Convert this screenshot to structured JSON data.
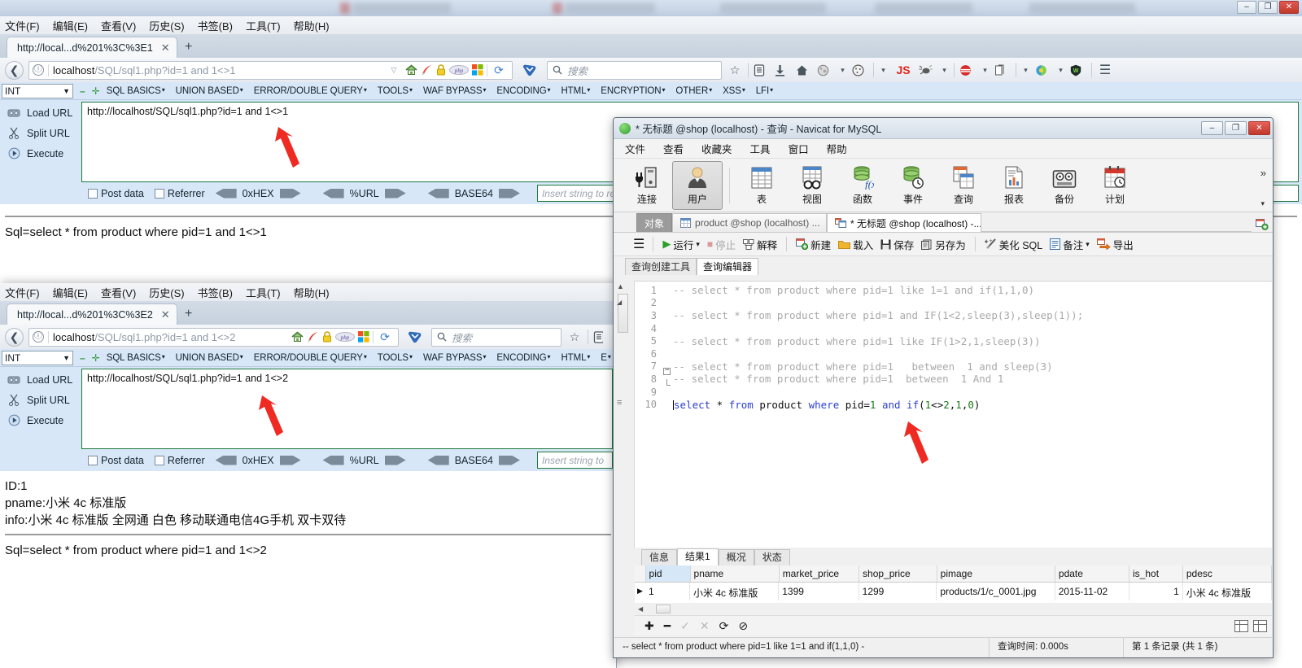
{
  "taskbar": {
    "minimize": "–",
    "maximize": "❐",
    "close": "✕"
  },
  "browser_back": {
    "menubar": [
      "文件(F)",
      "编辑(E)",
      "查看(V)",
      "历史(S)",
      "书签(B)",
      "工具(T)",
      "帮助(H)"
    ],
    "tab_title": "http://local...d%201%3C%3E1",
    "tab_close": "✕",
    "new_tab": "+",
    "back_arrow": "❮",
    "info_icon": "ⓘ",
    "url_host": "localhost",
    "url_path": "/SQL/sql1.php?id=1 and 1<>1",
    "reload": "⟳",
    "search_placeholder": "搜索",
    "hackbar": {
      "type_value": "INT",
      "dropdown_caret": "▼",
      "minus": "–",
      "plus": "✛",
      "menus": [
        "SQL BASICS",
        "UNION BASED",
        "ERROR/DOUBLE QUERY",
        "TOOLS",
        "WAF BYPASS",
        "ENCODING",
        "HTML",
        "ENCRYPTION",
        "OTHER",
        "XSS",
        "LFI"
      ],
      "load_url": "Load URL",
      "split_url": "Split URL",
      "execute": "Execute",
      "textarea_value": "http://localhost/SQL/sql1.php?id=1 and 1<>1",
      "post_data": "Post data",
      "referrer": "Referrer",
      "hex": "0xHEX",
      "url_enc": "%URL",
      "base64": "BASE64",
      "replace_placeholder": "Insert string to replace"
    },
    "page_sql": "Sql=select * from product where pid=1 and 1<>1"
  },
  "browser_front": {
    "menubar": [
      "文件(F)",
      "编辑(E)",
      "查看(V)",
      "历史(S)",
      "书签(B)",
      "工具(T)",
      "帮助(H)"
    ],
    "tab_title": "http://local...d%201%3C%3E2",
    "tab_close": "✕",
    "new_tab": "+",
    "back_arrow": "❮",
    "info_icon": "ⓘ",
    "url_host": "localhost",
    "url_path": "/SQL/sql1.php?id=1 and 1<>2",
    "reload": "⟳",
    "search_placeholder": "搜索",
    "hackbar": {
      "type_value": "INT",
      "dropdown_caret": "▼",
      "minus": "–",
      "plus": "✛",
      "menus": [
        "SQL BASICS",
        "UNION BASED",
        "ERROR/DOUBLE QUERY",
        "TOOLS",
        "WAF BYPASS",
        "ENCODING",
        "HTML",
        "E"
      ],
      "load_url": "Load URL",
      "split_url": "Split URL",
      "execute": "Execute",
      "textarea_value": "http://localhost/SQL/sql1.php?id=1 and 1<>2",
      "post_data": "Post data",
      "referrer": "Referrer",
      "hex": "0xHEX",
      "url_enc": "%URL",
      "base64": "BASE64",
      "replace_placeholder": "Insert string to rep"
    },
    "page_lines": [
      "ID:1",
      "pname:小米 4c 标准版",
      "info:小米 4c 标准版 全网通 白色 移动联通电信4G手机 双卡双待"
    ],
    "page_sql": "Sql=select * from product where pid=1 and 1<>2"
  },
  "navicat": {
    "title": "* 无标题 @shop (localhost) - 查询 - Navicat for MySQL",
    "window_controls": {
      "minimize": "–",
      "maximize": "❐",
      "close": "✕"
    },
    "menubar": [
      "文件",
      "查看",
      "收藏夹",
      "工具",
      "窗口",
      "帮助"
    ],
    "toolbar": [
      {
        "label": "连接",
        "icon": "connection-icon",
        "selected": false
      },
      {
        "label": "用户",
        "icon": "user-icon",
        "selected": true
      },
      {
        "label": "表",
        "icon": "table-icon",
        "selected": false
      },
      {
        "label": "视图",
        "icon": "view-icon",
        "selected": false
      },
      {
        "label": "函数",
        "icon": "function-icon",
        "selected": false
      },
      {
        "label": "事件",
        "icon": "event-icon",
        "selected": false
      },
      {
        "label": "查询",
        "icon": "query-icon",
        "selected": false
      },
      {
        "label": "报表",
        "icon": "report-icon",
        "selected": false
      },
      {
        "label": "备份",
        "icon": "backup-icon",
        "selected": false
      },
      {
        "label": "计划",
        "icon": "schedule-icon",
        "selected": false
      }
    ],
    "toolbar_overflow": "»",
    "tabs": [
      {
        "label": "对象",
        "kind": "objects"
      },
      {
        "label": "product @shop (localhost) ...",
        "kind": "table"
      },
      {
        "label": "* 无标题 @shop (localhost) -...",
        "kind": "query",
        "active": true
      }
    ],
    "query_toolbar": {
      "menu_icon": "hamburger-icon",
      "run": "运行",
      "run_caret": "▾",
      "stop": "停止",
      "explain": "解释",
      "new": "新建",
      "load": "载入",
      "save": "保存",
      "save_as": "另存为",
      "beautify": "美化 SQL",
      "note": "备注",
      "note_caret": "▾",
      "export": "导出"
    },
    "sub_tabs": [
      {
        "label": "查询创建工具",
        "active": false
      },
      {
        "label": "查询编辑器",
        "active": true
      }
    ],
    "editor_lines": [
      {
        "n": "1",
        "text": "-- select * from product where pid=1 like 1=1 and if(1,1,0)",
        "active": false,
        "fold": ""
      },
      {
        "n": "2",
        "text": "",
        "active": false,
        "fold": ""
      },
      {
        "n": "3",
        "text": "-- select * from product where pid=1 and IF(1<2,sleep(3),sleep(1));",
        "active": false,
        "fold": ""
      },
      {
        "n": "4",
        "text": "",
        "active": false,
        "fold": ""
      },
      {
        "n": "5",
        "text": "-- select * from product where pid=1 like IF(1>2,1,sleep(3))",
        "active": false,
        "fold": ""
      },
      {
        "n": "6",
        "text": "",
        "active": false,
        "fold": ""
      },
      {
        "n": "7",
        "text": "-- select * from product where pid=1   between  1 and sleep(3)",
        "active": false,
        "fold": "start"
      },
      {
        "n": "8",
        "text": "-- select * from product where pid=1  between  1 And 1",
        "active": false,
        "fold": "end"
      },
      {
        "n": "9",
        "text": "",
        "active": false,
        "fold": ""
      },
      {
        "n": "10",
        "text": "select * from product where pid=1 and if(1<>2,1,0)",
        "active": true,
        "fold": ""
      }
    ],
    "result_tabs": [
      {
        "label": "信息",
        "active": false
      },
      {
        "label": "结果1",
        "active": true
      },
      {
        "label": "概况",
        "active": false
      },
      {
        "label": "状态",
        "active": false
      }
    ],
    "result_columns": [
      "pid",
      "pname",
      "market_price",
      "shop_price",
      "pimage",
      "pdate",
      "is_hot",
      "pdesc"
    ],
    "result_rows": [
      {
        "marker": "▶",
        "cells": [
          "1",
          "小米 4c 标准版",
          "1399",
          "1299",
          "products/1/c_0001.jpg",
          "2015-11-02",
          "1",
          "小米 4c 标准版"
        ]
      }
    ],
    "bottom_bar": {
      "add": "✚",
      "remove": "━",
      "confirm": "✓",
      "cancel": "✕",
      "refresh": "⟳",
      "stop": "⊘",
      "grid_view": "grid-view-icon",
      "form_view": "form-view-icon"
    },
    "status": {
      "query_text": "-- select * from product where pid=1 like 1=1 and if(1,1,0)  -",
      "query_time": "查询时间: 0.000s",
      "record_info": "第 1 条记录 (共 1 条)"
    }
  }
}
